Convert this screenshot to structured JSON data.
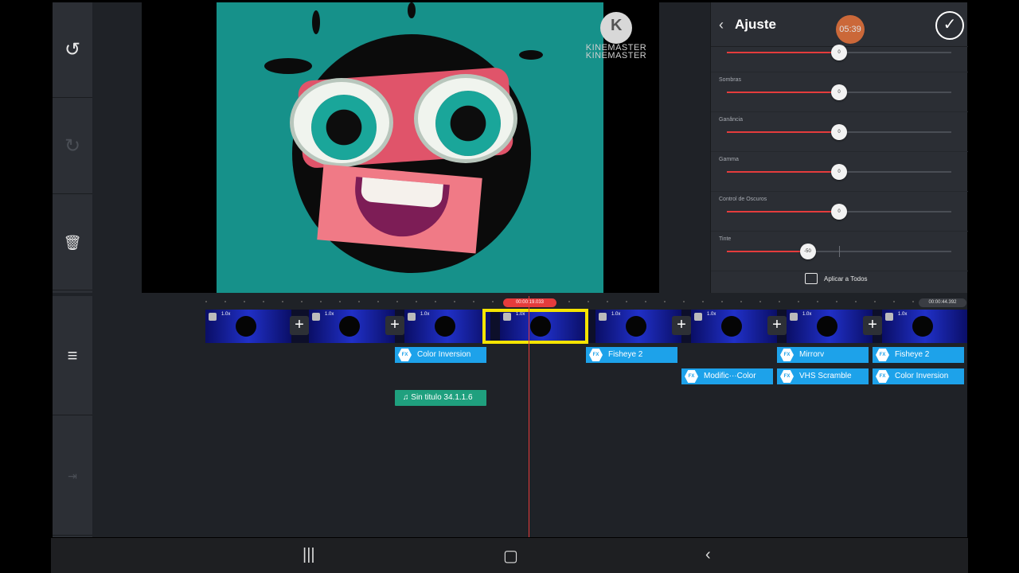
{
  "toolbar": {
    "undo_icon": "undo-icon",
    "redo_icon": "redo-icon",
    "delete_icon": "trash-icon"
  },
  "preview": {
    "watermark_line1": "KINEMASTER",
    "watermark_line2": "KINEMASTER",
    "watermark_logo": "K"
  },
  "panel": {
    "title": "Ajuste",
    "record_time": "05:39",
    "sliders": [
      {
        "label": "",
        "value": "0",
        "level": 0.5
      },
      {
        "label": "Sombras",
        "value": "0",
        "level": 0.5
      },
      {
        "label": "Ganância",
        "value": "0",
        "level": 0.5
      },
      {
        "label": "Gamma",
        "value": "0",
        "level": 0.5
      },
      {
        "label": "Control de Oscuros",
        "value": "0",
        "level": 0.5
      },
      {
        "label": "Tinte",
        "value": "-50",
        "level": 0.36
      }
    ],
    "apply_all": "Aplicar a Todos"
  },
  "timeline": {
    "current_time": "00:00:19.033",
    "total_time": "00:00:44.392",
    "clip_speed": "1.0x",
    "layers_row1": [
      "Color Inversion",
      "Fisheye 2",
      "Mirrorv",
      "Fisheye 2"
    ],
    "layers_row2": [
      "Modific···Color",
      "VHS Scramble",
      "Color Inversion"
    ],
    "audio_label": "Sin titulo 34.1.1.6",
    "fx_badge": "FX"
  },
  "colors": {
    "accent_red": "#e53c3c",
    "layer_blue": "#1da2ea",
    "audio_green": "#1fa07e",
    "selection_yellow": "#f5e400"
  }
}
